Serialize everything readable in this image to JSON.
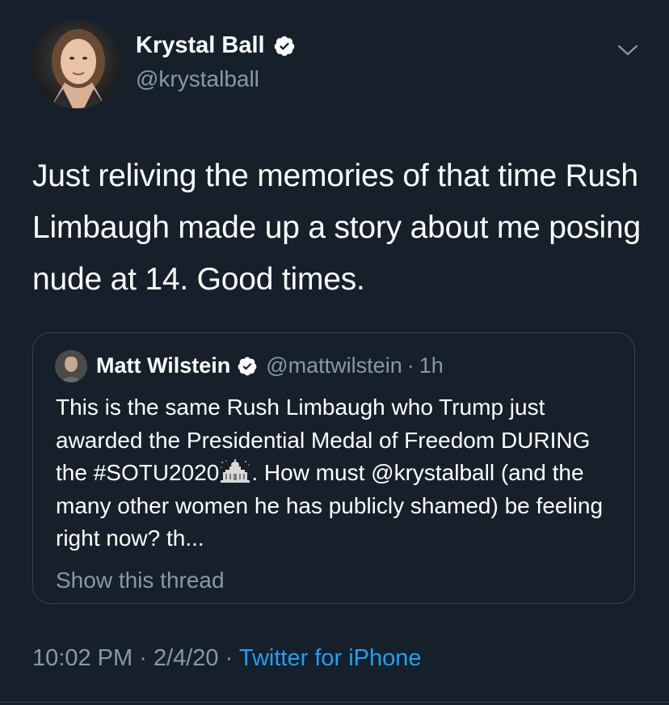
{
  "tweet": {
    "author": {
      "name": "Krystal Ball",
      "handle": "@krystalball",
      "verified": true,
      "avatar_icon": "profile-photo"
    },
    "text": "Just reliving the memories of that time Rush Limbaugh made up a story about me posing nude at 14. Good times.",
    "menu_icon": "chevron-down-icon",
    "quoted_tweet": {
      "author_name": "Matt Wilstein",
      "author_handle": "@mattwilstein",
      "separator": "·",
      "relative_time": "1h",
      "verified": true,
      "text_before_emoji": "This is the same Rush Limbaugh who Trump just awarded the Presidential Medal of Freedom DURING the #SOTU2020",
      "emoji": "capitol-building-icon",
      "text_after_emoji": ". How must @krystalball (and the many other women he has publicly shamed) be feeling right now? th...",
      "show_thread_label": "Show this thread"
    },
    "metadata": {
      "time": "10:02 PM",
      "separator": "·",
      "date": "2/4/20",
      "source": "Twitter for iPhone"
    }
  },
  "colors": {
    "background": "#15202b",
    "primary_text": "#ffffff",
    "secondary_text": "#8899a6",
    "accent": "#1da1f2",
    "border": "#38444d"
  }
}
